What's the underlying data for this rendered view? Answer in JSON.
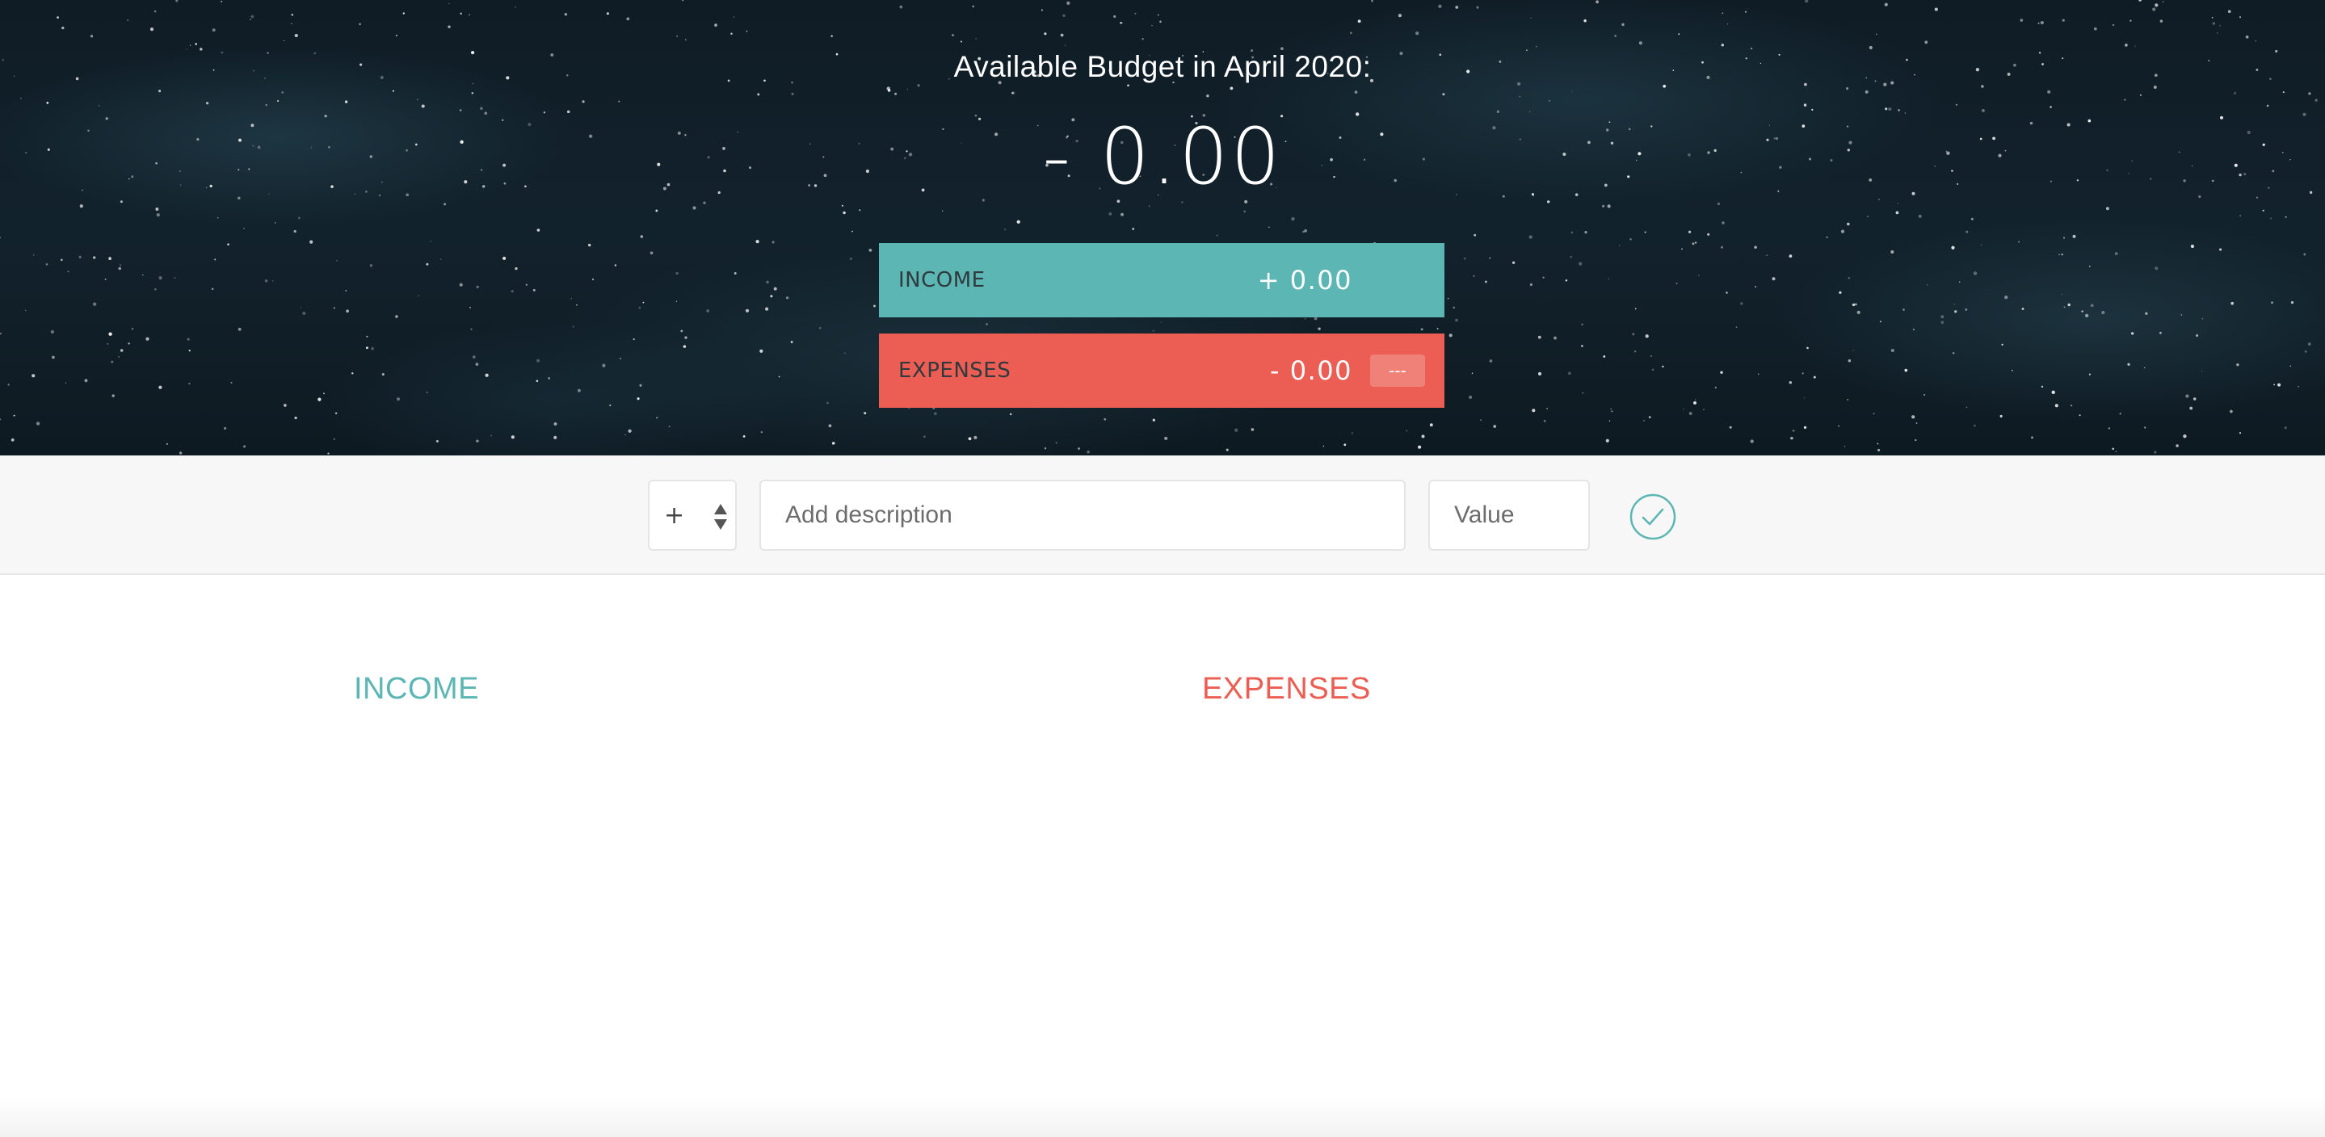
{
  "budget": {
    "title": "Available Budget in April 2020:",
    "value": "- 0.00"
  },
  "summary": {
    "income": {
      "label": "INCOME",
      "value": "+ 0.00"
    },
    "expenses": {
      "label": "EXPENSES",
      "value": "- 0.00",
      "percentage": "---"
    }
  },
  "add_form": {
    "type_value": "+",
    "description_placeholder": "Add description",
    "value_placeholder": "Value",
    "submit_icon": "check-circle-icon"
  },
  "lists": {
    "income_title": "INCOME",
    "expenses_title": "EXPENSES"
  },
  "colors": {
    "income": "#5cb6b3",
    "expenses": "#ec5e53",
    "hero_background": "#12222c"
  }
}
